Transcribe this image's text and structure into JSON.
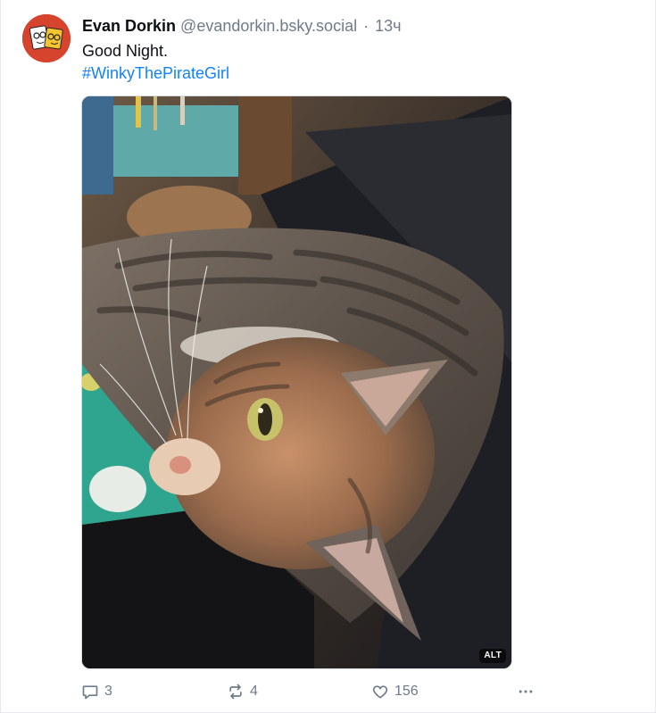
{
  "post": {
    "author": {
      "display_name": "Evan Dorkin",
      "handle": "@evandorkin.bsky.social",
      "separator": "·",
      "timestamp": "13ч"
    },
    "text": "Good Night.",
    "hashtag": "#WinkyThePirateGirl",
    "media": {
      "alt_badge": "ALT"
    },
    "actions": {
      "replies": "3",
      "reposts": "4",
      "likes": "156"
    }
  },
  "colors": {
    "link": "#1083fe",
    "muted": "#6f7b8b",
    "avatar_bg": "#d6442e"
  }
}
